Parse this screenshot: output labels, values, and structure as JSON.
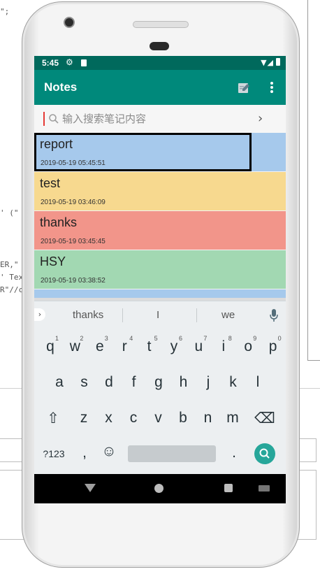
{
  "background": {
    "code_lines": [
      {
        "text": "\";"
      },
      {
        "text": "' (\""
      },
      {
        "text": "ER,\""
      },
      {
        "text": "' Text"
      },
      {
        "text": "R\"//c"
      }
    ]
  },
  "status_bar": {
    "time": "5:45",
    "gear_icon": "gear-icon",
    "sd_icon": "sd-card-icon",
    "signal_text": "▼◢"
  },
  "app_bar": {
    "title": "Notes",
    "edit_icon": "edit-note-icon",
    "overflow_icon": "overflow-menu-icon"
  },
  "search": {
    "placeholder": "输入搜索笔记内容",
    "value": "",
    "go_label": "›"
  },
  "notes": [
    {
      "title": "report",
      "timestamp": "2019-05-19 05:45:51",
      "color": "#a6c9ec"
    },
    {
      "title": "test",
      "timestamp": "2019-05-19 03:46:09",
      "color": "#f7d98f"
    },
    {
      "title": "thanks",
      "timestamp": "2019-05-19 03:45:45",
      "color": "#f2958a"
    },
    {
      "title": "HSY",
      "timestamp": "2019-05-19 03:38:52",
      "color": "#a2d8b2"
    }
  ],
  "keyboard": {
    "toggle_label": "›",
    "suggestions": [
      "thanks",
      "I",
      "we"
    ],
    "row1": [
      "q",
      "w",
      "e",
      "r",
      "t",
      "y",
      "u",
      "i",
      "o",
      "p"
    ],
    "row1_hints": [
      "1",
      "2",
      "3",
      "4",
      "5",
      "6",
      "7",
      "8",
      "9",
      "0"
    ],
    "row2": [
      "a",
      "s",
      "d",
      "f",
      "g",
      "h",
      "j",
      "k",
      "l"
    ],
    "shift_label": "⇧",
    "row3": [
      "z",
      "x",
      "c",
      "v",
      "b",
      "n",
      "m"
    ],
    "backspace_label": "⌫",
    "symbols_label": "?123",
    "comma_label": ",",
    "emoji_label": "☺",
    "period_label": ".",
    "enter_icon": "search-icon"
  },
  "colors": {
    "status_bar": "#00695c",
    "app_bar": "#00897b",
    "accent": "#26a69a"
  }
}
